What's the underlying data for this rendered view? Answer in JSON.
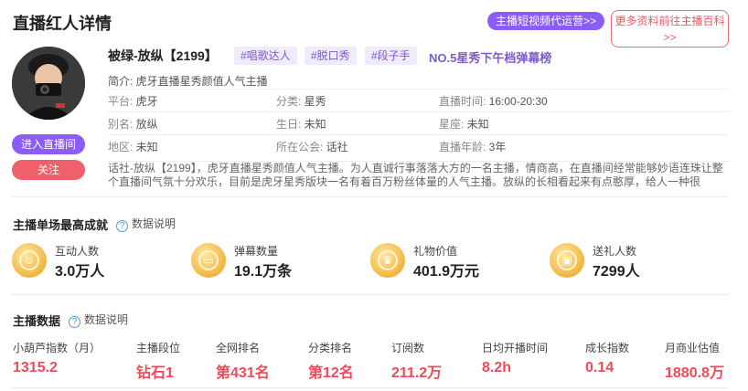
{
  "page": {
    "title": "直播红人详情",
    "ops_button": "主播短视频代运营>>",
    "wiki_button_line1": "更多资料前往主播百科",
    "wiki_button_line2": ">>"
  },
  "profile": {
    "name": "被绿-放纵【2199】",
    "tags": [
      "#唱歌达人",
      "#脱口秀",
      "#段子手"
    ],
    "rank": "NO.5星秀下午档弹幕榜",
    "intro": "简介: 虎牙直播星秀颜值人气主播",
    "live_button": "进入直播间",
    "follow_button": "关注",
    "info": [
      [
        {
          "k": "平台: ",
          "v": "虎牙"
        },
        {
          "k": "分类: ",
          "v": "星秀"
        },
        {
          "k": "直播时间: ",
          "v": "16:00-20:30"
        }
      ],
      [
        {
          "k": "别名: ",
          "v": "放纵"
        },
        {
          "k": "生日: ",
          "v": "未知"
        },
        {
          "k": "星座: ",
          "v": "未知"
        }
      ],
      [
        {
          "k": "地区: ",
          "v": "未知"
        },
        {
          "k": "所在公会: ",
          "v": "话社"
        },
        {
          "k": "直播年龄: ",
          "v": "3年"
        }
      ]
    ],
    "bio": "话社-放纵【2199】，虎牙直播星秀颜值人气主播。为人直诚行事落落大方的一名主播，情商高，在直播间经常能够妙语连珠让整个直播间气氛十分欢乐，目前是虎牙星秀版块一名有着百万粉丝体量的人气主播。放纵的长相看起来有点憨厚，给人一种很"
  },
  "best": {
    "title": "主播单场最高成就",
    "help": "数据说明",
    "items": [
      {
        "label": "互动人数",
        "value": "3.0万人",
        "icon": "people-icon"
      },
      {
        "label": "弹幕数量",
        "value": "19.1万条",
        "icon": "chat-icon"
      },
      {
        "label": "礼物价值",
        "value": "401.9万元",
        "icon": "crown-icon"
      },
      {
        "label": "送礼人数",
        "value": "7299人",
        "icon": "gift-icon"
      }
    ]
  },
  "metrics": {
    "title": "主播数据",
    "help": "数据说明",
    "items": [
      {
        "label": "小葫芦指数（月）",
        "value": "1315.2"
      },
      {
        "label": "主播段位",
        "value": "钻石1"
      },
      {
        "label": "全网排名",
        "value": "第431名"
      },
      {
        "label": "分类排名",
        "value": "第12名"
      },
      {
        "label": "订阅数",
        "value": "211.2万"
      },
      {
        "label": "日均开播时间",
        "value": "8.2h"
      },
      {
        "label": "成长指数",
        "value": "0.14"
      },
      {
        "label": "月商业估值",
        "value": "1880.8万"
      }
    ]
  }
}
